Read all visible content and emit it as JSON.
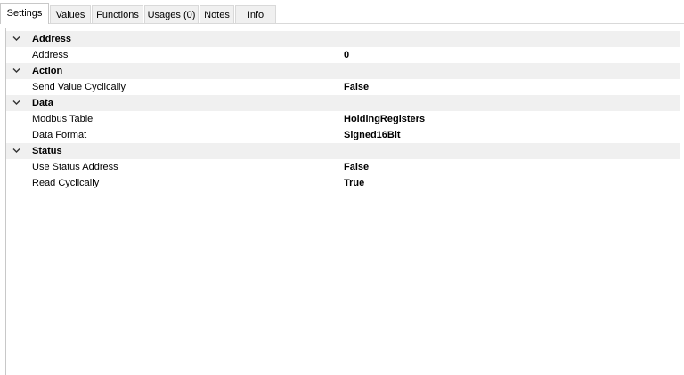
{
  "tabs": [
    {
      "label": "Settings",
      "active": true
    },
    {
      "label": "Values",
      "active": false
    },
    {
      "label": "Functions",
      "active": false
    },
    {
      "label": "Usages (0)",
      "active": false
    },
    {
      "label": "Notes",
      "active": false
    },
    {
      "label": "Info",
      "active": false
    }
  ],
  "property_grid": {
    "categories": [
      {
        "name": "Address",
        "icon": "chevron-down-icon",
        "expanded": true,
        "properties": [
          {
            "name": "Address",
            "value": "0"
          }
        ]
      },
      {
        "name": "Action",
        "icon": "chevron-down-icon",
        "expanded": true,
        "properties": [
          {
            "name": "Send Value Cyclically",
            "value": "False"
          }
        ]
      },
      {
        "name": "Data",
        "icon": "chevron-down-icon",
        "expanded": true,
        "properties": [
          {
            "name": "Modbus Table",
            "value": "HoldingRegisters"
          },
          {
            "name": "Data Format",
            "value": "Signed16Bit"
          }
        ]
      },
      {
        "name": "Status",
        "icon": "chevron-down-icon",
        "expanded": true,
        "properties": [
          {
            "name": "Use Status Address",
            "value": "False"
          },
          {
            "name": "Read Cyclically",
            "value": "True"
          }
        ]
      }
    ]
  },
  "colors": {
    "category_background": "#f0f0f0",
    "border": "#c8c8c8"
  }
}
